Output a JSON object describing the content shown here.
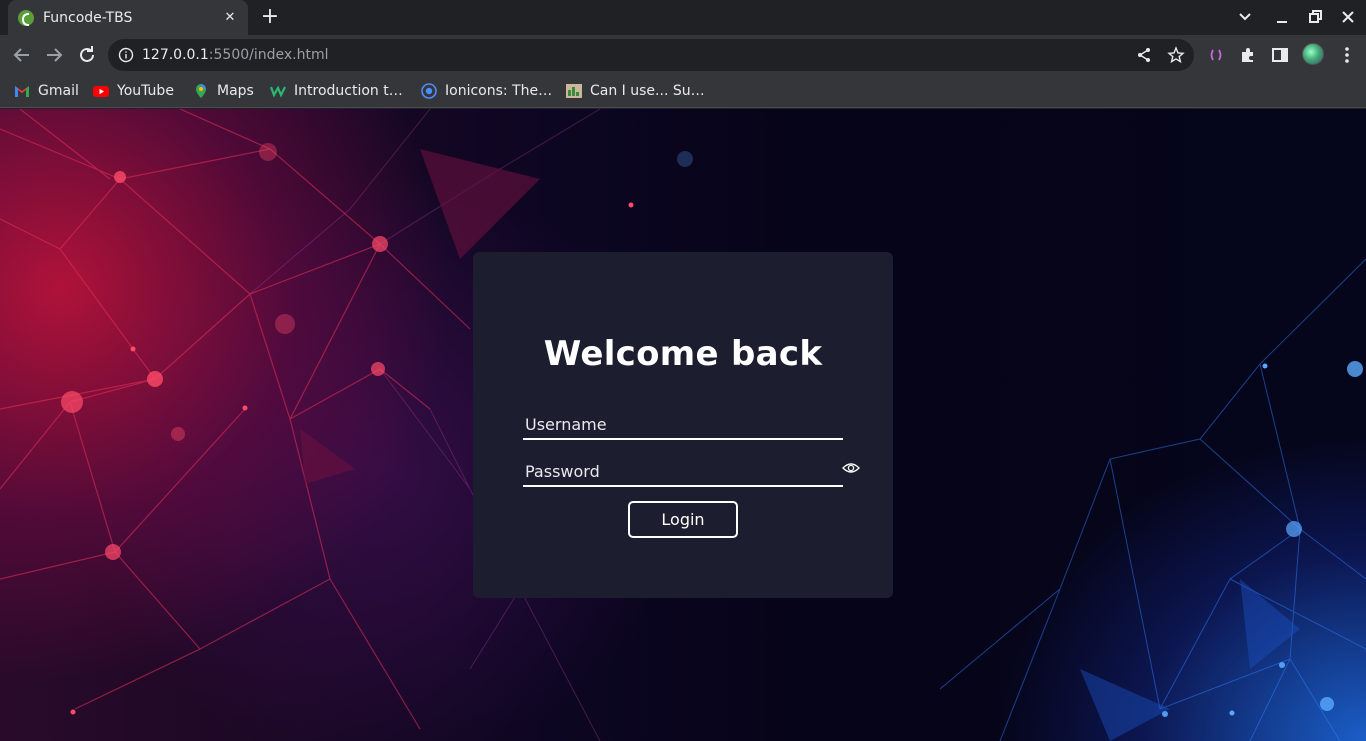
{
  "browser": {
    "tab": {
      "title": "Funcode-TBS",
      "close_glyph": "✕",
      "favicon": "funcode-icon"
    },
    "new_tab_glyph": "+",
    "address": {
      "host": "127.0.0.1",
      "path": ":5500/index.html"
    },
    "bookmarks": [
      {
        "label": "Gmail",
        "icon": "gmail-icon"
      },
      {
        "label": "YouTube",
        "icon": "youtube-icon"
      },
      {
        "label": "Maps",
        "icon": "maps-icon"
      },
      {
        "label": "Introduction t…",
        "icon": "w-icon"
      },
      {
        "label": "Ionicons: The…",
        "icon": "ionicons-icon"
      },
      {
        "label": "Can I use... Su…",
        "icon": "caniuse-icon"
      }
    ]
  },
  "login": {
    "title": "Welcome back",
    "username_placeholder": "Username",
    "password_placeholder": "Password",
    "button_label": "Login"
  },
  "colors": {
    "card": "#1d1d30",
    "accent_red": "#c8143c",
    "accent_blue": "#1e6ee6"
  }
}
